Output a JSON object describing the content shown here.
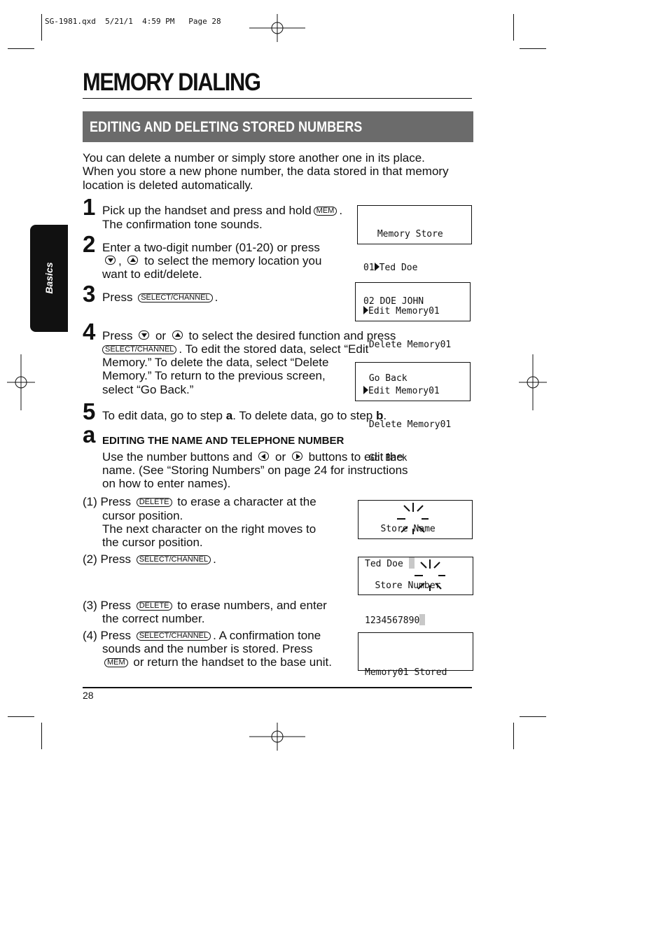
{
  "slug": "SG-1981.qxd  5/21/1  4:59 PM   Page 28",
  "title": "MEMORY DIALING",
  "section": "EDITING AND DELETING STORED NUMBERS",
  "side_tab": "Basics",
  "keys": {
    "mem": "MEM",
    "select": "SELECT/CHANNEL",
    "delete": "DELETE"
  },
  "intro": [
    "You can delete a number or simply store another one in its place.",
    "When you store a new phone number, the data stored in that memory",
    "location is deleted automatically."
  ],
  "steps": {
    "s1": {
      "n": "1",
      "a": "Pick up the handset and press and hold",
      "b": ".",
      "c": "The confirmation tone sounds."
    },
    "s2": {
      "n": "2",
      "a": "Enter a two-digit number (01-20) or press",
      "b": ",",
      "c": "to select the memory location you",
      "d": "want to edit/delete."
    },
    "s3": {
      "n": "3",
      "a": "Press",
      "b": "."
    },
    "s4": {
      "n": "4",
      "a": "Press",
      "or": "or",
      "b": "to select the desired function and press",
      "c": ".  To edit the stored data, select “Edit",
      "d": "Memory.”  To delete the data, select “Delete",
      "e": "Memory.”  To return to the previous screen,",
      "f": "select “Go Back.”"
    },
    "s5": {
      "n": "5",
      "a": "To edit data, go to step ",
      "a_bold": "a",
      "b": ". To delete data, go to step ",
      "b_bold": "b",
      "c": "."
    },
    "sa": {
      "n": "a",
      "heading": "EDITING THE NAME AND TELEPHONE NUMBER",
      "a": "Use the number buttons and",
      "or": "or",
      "b": "buttons to edit the",
      "c": "name.  (See “Storing Numbers” on page 24 for instructions",
      "d": "on how to enter names)."
    }
  },
  "sub": {
    "p1": {
      "lbl": "(1) Press",
      "a": "to erase a character at the",
      "b": "cursor position.",
      "c": "The next character on the right moves to",
      "d": "the cursor position."
    },
    "p2": {
      "lbl": "(2) Press",
      "a": "."
    },
    "p3": {
      "lbl": "(3) Press",
      "a": "to erase numbers, and enter",
      "b": "the correct number."
    },
    "p4": {
      "lbl": "(4) Press",
      "a": ". A confirmation tone",
      "b": "sounds and the number is stored.  Press",
      "c": "or return the handset to the base unit."
    }
  },
  "lcd": {
    "d1": [
      " Memory Store",
      "01",
      "Ted Doe",
      "02 DOE JOHN"
    ],
    "d2": [
      "Edit Memory01",
      " Delete Memory01",
      " Go Back"
    ],
    "d3": [
      "Edit Memory01",
      " Delete Memory01",
      " Go Back"
    ],
    "d4": [
      "   Store Name",
      "Ted Doe"
    ],
    "d5": [
      "   Store Number",
      "1234567890"
    ],
    "d6": "Memory01 Stored"
  },
  "page_number": "28",
  "colors": {
    "banner": "#6b6b6b",
    "side_tab": "#111111"
  }
}
